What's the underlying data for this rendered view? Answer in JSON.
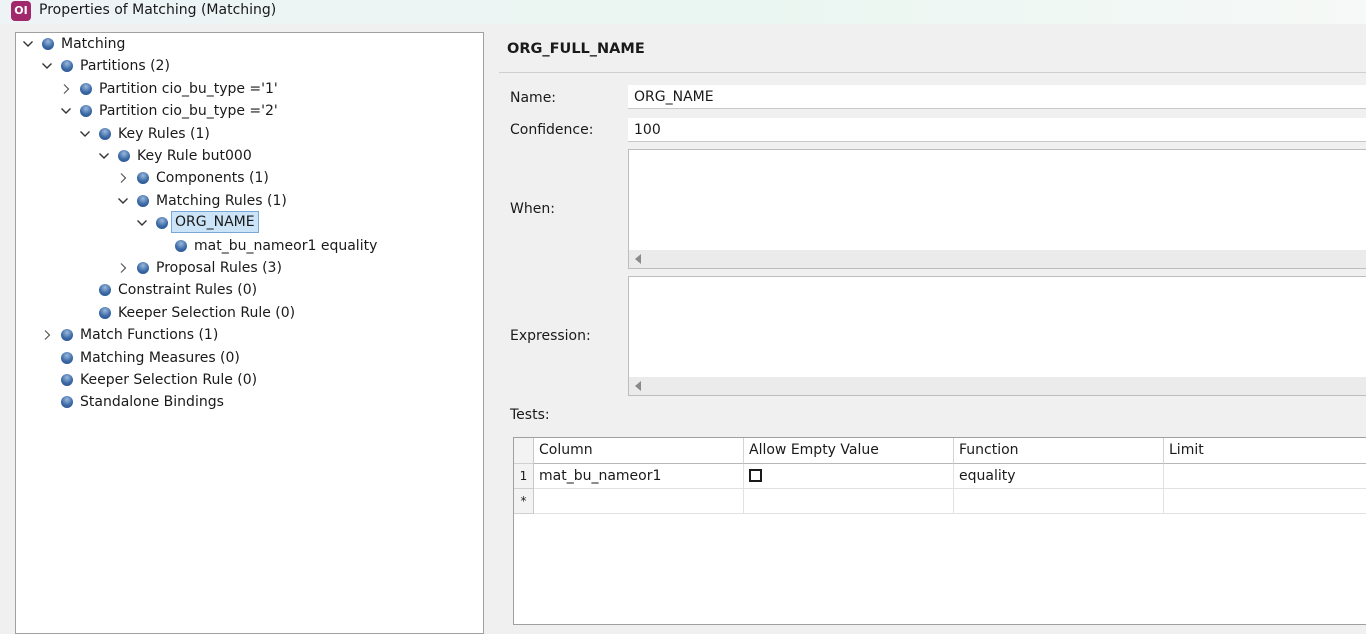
{
  "window": {
    "title": "Properties of Matching (Matching)",
    "app_icon_text": "OI",
    "accent": "#a1296b"
  },
  "tree": {
    "nodes": [
      {
        "label": "Matching",
        "expander": "expanded"
      },
      {
        "label": "Partitions (2)",
        "expander": "expanded"
      },
      {
        "label": "Partition cio_bu_type ='1'",
        "expander": "collapsed"
      },
      {
        "label": "Partition cio_bu_type ='2'",
        "expander": "expanded"
      },
      {
        "label": "Key Rules (1)",
        "expander": "expanded"
      },
      {
        "label": "Key Rule but000",
        "expander": "expanded"
      },
      {
        "label": "Components (1)",
        "expander": "collapsed"
      },
      {
        "label": "Matching Rules (1)",
        "expander": "expanded"
      },
      {
        "label": "ORG_NAME",
        "expander": "expanded",
        "selected": true
      },
      {
        "label": "mat_bu_nameor1 equality",
        "expander": "none"
      },
      {
        "label": "Proposal Rules (3)",
        "expander": "collapsed"
      },
      {
        "label": "Constraint Rules (0)",
        "expander": "none"
      },
      {
        "label": "Keeper Selection Rule (0)",
        "expander": "none"
      },
      {
        "label": "Match Functions (1)",
        "expander": "collapsed"
      },
      {
        "label": "Matching Measures (0)",
        "expander": "none"
      },
      {
        "label": "Keeper Selection Rule (0)",
        "expander": "none"
      },
      {
        "label": "Standalone Bindings",
        "expander": "none"
      }
    ]
  },
  "details": {
    "heading": "ORG_FULL_NAME",
    "name_label": "Name:",
    "name_value": "ORG_NAME",
    "confidence_label": "Confidence:",
    "confidence_value": "100",
    "when_label": "When:",
    "when_value": "",
    "expression_label": "Expression:",
    "expression_value": "",
    "tests_label": "Tests:"
  },
  "tests_grid": {
    "columns": [
      "Column",
      "Allow Empty Value",
      "Function",
      "Limit"
    ],
    "rows": [
      {
        "row_header": "1",
        "column": "mat_bu_nameor1",
        "allow_empty": false,
        "function": "equality",
        "limit": ""
      }
    ],
    "new_row_marker": "*"
  }
}
